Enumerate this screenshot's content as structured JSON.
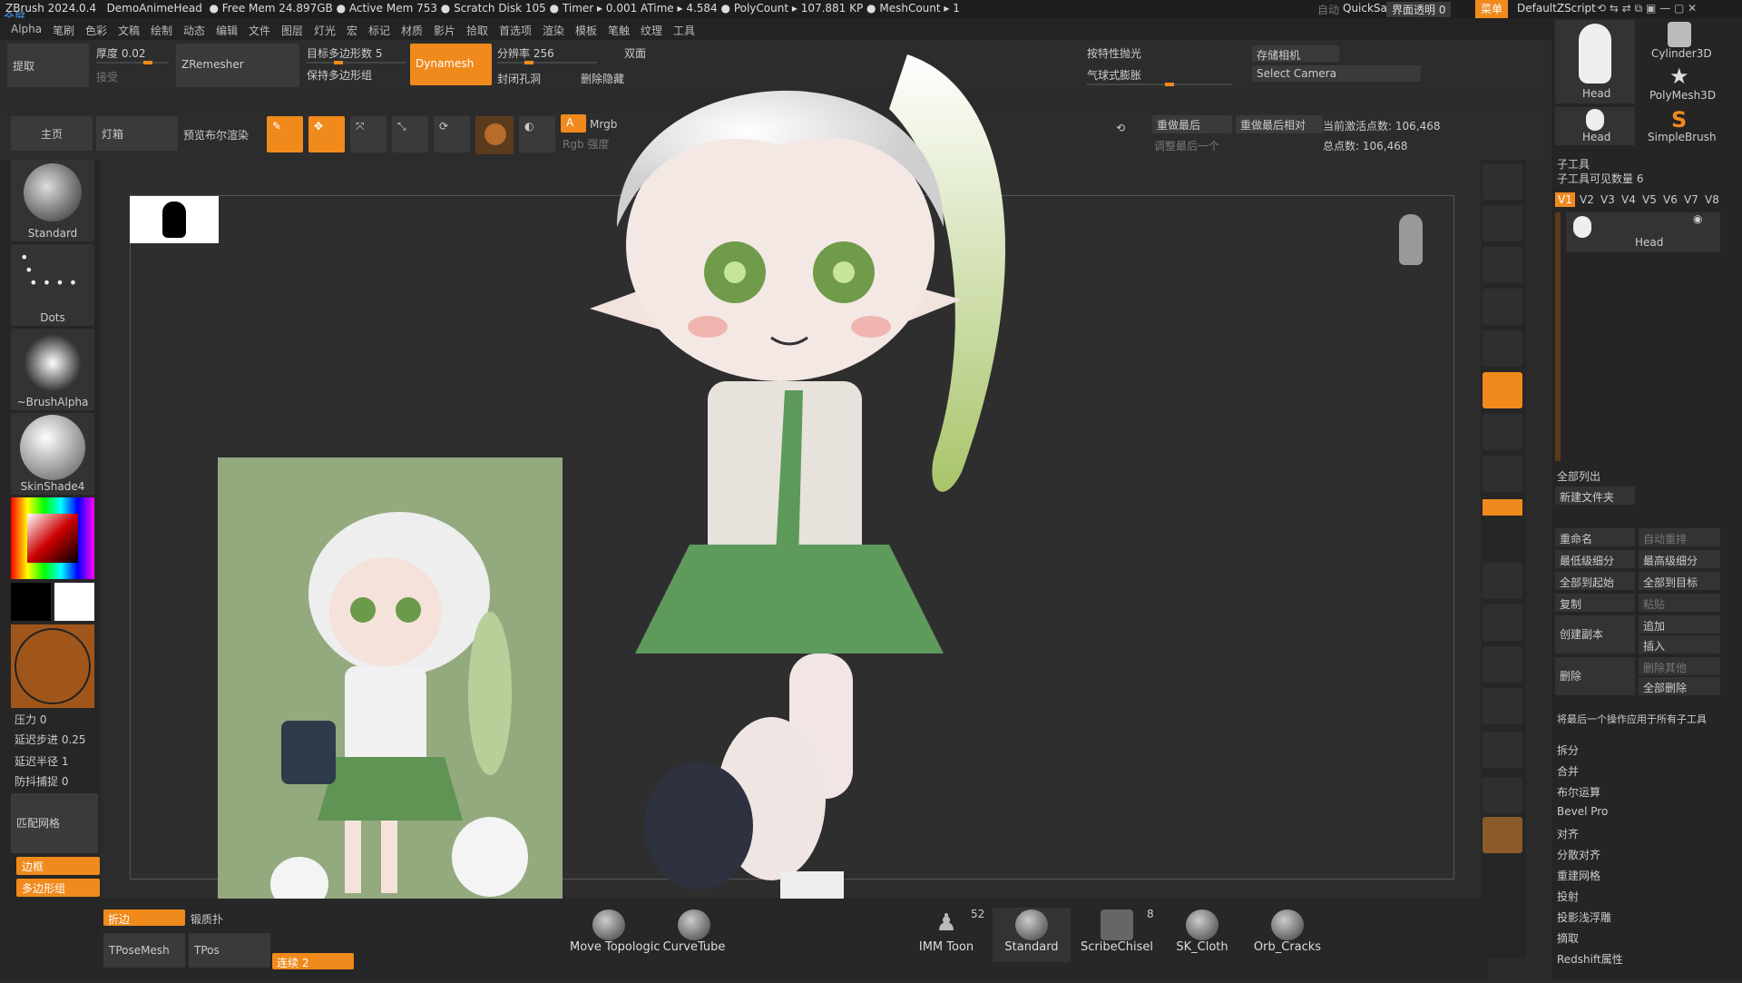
{
  "title": {
    "app": "ZBrush 2024.0.4",
    "tool": "DemoAnimeHead",
    "free_mem": "Free Mem 24.897GB",
    "active_mem": "Active Mem 753",
    "scratch": "Scratch Disk 105",
    "timer": "Timer ▸ 0.001 ATime ▸ 4.584",
    "polycount": "PolyCount ▸ 107.881 KP",
    "meshcount": "MeshCount ▸ 1",
    "fullscreen": "全屏",
    "auto": "自动",
    "quicksave": "QuickSave",
    "transparency": "界面透明 0",
    "menu": "菜单",
    "script": "DefaultZScript"
  },
  "menu": [
    "Alpha",
    "笔刷",
    "色彩",
    "文稿",
    "绘制",
    "动态",
    "编辑",
    "文件",
    "图层",
    "灯光",
    "宏",
    "标记",
    "材质",
    "影片",
    "拾取",
    "首选项",
    "渲染",
    "模板",
    "笔触",
    "纹理",
    "工具"
  ],
  "toolbar": {
    "extract": "提取",
    "thickness": "厚度 0.02",
    "accept": "接受",
    "zremesher": "ZRemesher",
    "target_poly": "目标多边形数 5",
    "keep_polygroups": "保持多边形组",
    "dynamesh": "Dynamesh",
    "resolution": "分辨率 256",
    "double_sided": "双面",
    "close_holes": "封闭孔洞",
    "delete_hidden": "删除隐藏",
    "by_feature": "按特性抛光",
    "balloon": "气球式膨胀",
    "store_camera": "存储相机",
    "select_camera": "Select Camera"
  },
  "toolbar2": {
    "home": "主页",
    "lightbox": "灯箱",
    "preview_boolean": "预览布尔渲染",
    "mode_a": "A",
    "mrgb": "Mrgb",
    "rgb": "Rgb 强度",
    "redo_last": "重做最后",
    "redo_last_rel": "重做最后相对",
    "adjust_last": "调整最后一个",
    "active_points": "当前激活点数: 106,468",
    "total_points": "总点数: 106,468"
  },
  "left": {
    "brushes": [
      "Standard",
      "Dots",
      "~BrushAlpha",
      "SkinShade4"
    ],
    "pressure": "压力 0",
    "lazy_step": "延迟步进 0.25",
    "lazy_radius": "延迟半径 1",
    "jitter": "防抖捕捉 0",
    "match_grid": "匹配网格",
    "frame": "边框",
    "polygroup": "多边形组"
  },
  "bottom_left": {
    "crease": "折边",
    "crease2": "锻质扑",
    "tpose": "TPoseMesh",
    "tpose2": "TPos",
    "continue": "连续 2"
  },
  "shelf": [
    {
      "name": "Move Topologic"
    },
    {
      "name": "CurveTube"
    },
    {
      "name": "IMM Toon",
      "count": "52"
    },
    {
      "name": "Standard"
    },
    {
      "name": "ScribeChisel",
      "count": "8"
    },
    {
      "name": "SK_Cloth"
    },
    {
      "name": "Orb_Cracks"
    }
  ],
  "right_tools": [
    {
      "name": "Head"
    },
    {
      "name": "Cylinder3D"
    },
    {
      "name": "PolyMesh3D"
    },
    {
      "name": "Head"
    },
    {
      "name": "SimpleBrush"
    }
  ],
  "subtool": {
    "header": "子工具",
    "visible": "子工具可见数量 6",
    "versions": [
      "V1",
      "V2",
      "V3",
      "V4",
      "V5",
      "V6",
      "V7",
      "V8"
    ],
    "item": "Head",
    "list_all": "全部列出",
    "new_folder": "新建文件夹",
    "rename": "重命名",
    "auto_reorder": "自动重排",
    "lowest": "最低级细分",
    "highest": "最高级细分",
    "all_low": "全部到起始",
    "all_high": "全部到目标",
    "copy": "复制",
    "paste": "粘贴",
    "duplicate": "创建副本",
    "append": "追加",
    "insert": "插入",
    "delete": "删除",
    "delete_other": "删除其他",
    "delete_all": "全部删除",
    "apply_all": "将最后一个操作应用于所有子工具",
    "split": "拆分",
    "merge": "合并",
    "boolean": "布尔运算",
    "bevel": "Bevel Pro",
    "align": "对齐",
    "distribute": "分散对齐",
    "remesh": "重建网格",
    "project": "投射",
    "proj_relief": "投影浅浮雕",
    "extract2": "摘取",
    "redshift": "Redshift属性"
  },
  "colors": {
    "accent": "#f08a1c",
    "panel": "#2c2c2c"
  }
}
